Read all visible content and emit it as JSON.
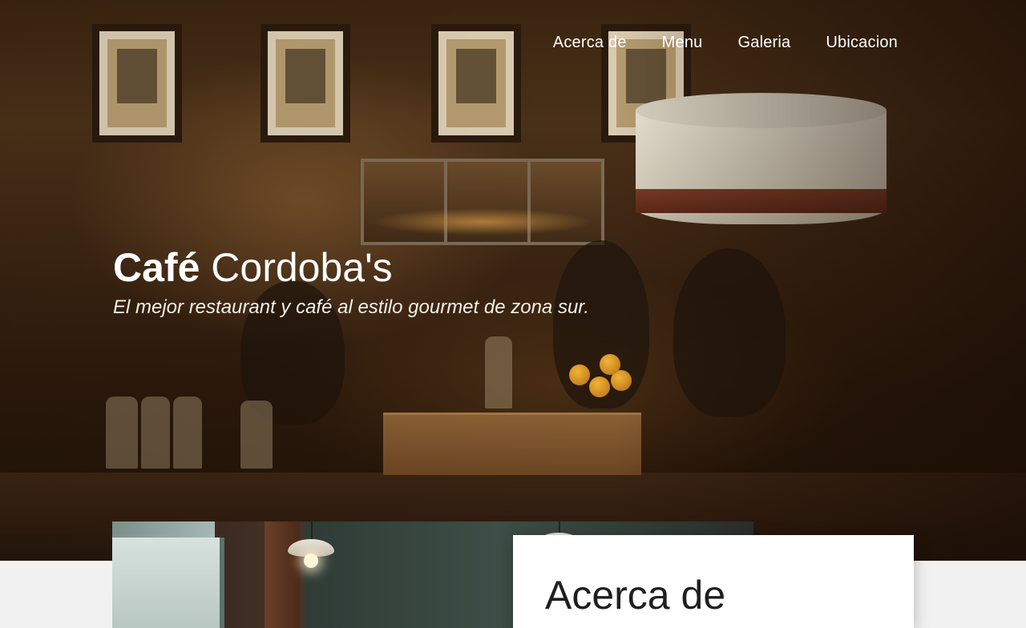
{
  "nav": {
    "items": [
      {
        "label": "Acerca de"
      },
      {
        "label": "Menu"
      },
      {
        "label": "Galeria"
      },
      {
        "label": "Ubicacion"
      }
    ]
  },
  "hero": {
    "title_bold": "Café",
    "title_rest": "Cordoba's",
    "subtitle": "El mejor restaurant y café al estilo gourmet de zona sur."
  },
  "about": {
    "heading": "Acerca de"
  },
  "colors": {
    "nav_text": "#ffffff",
    "hero_overlay": "#2a180a",
    "page_background": "#f1f1f1",
    "card_background": "#ffffff"
  },
  "icons": []
}
